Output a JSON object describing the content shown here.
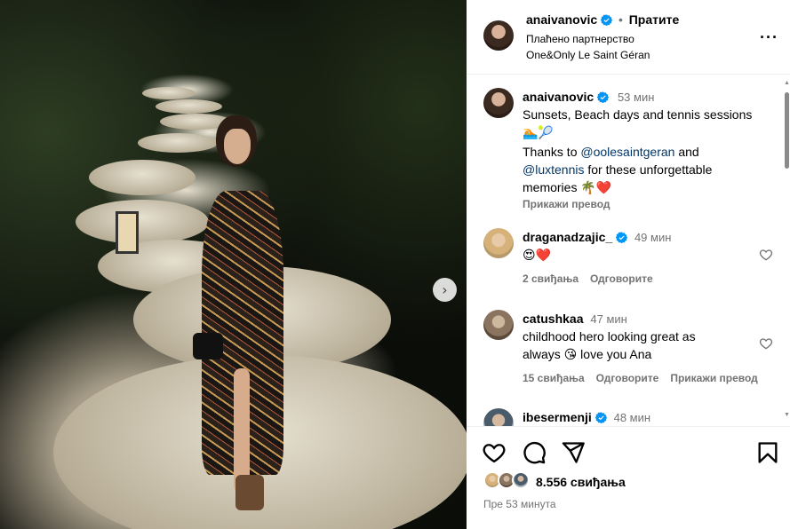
{
  "post": {
    "author": "anaivanovic",
    "follow_label": "Пратите",
    "separator": "•",
    "partnership": "Плаћено партнерство",
    "location": "One&Only Le Saint Géran"
  },
  "caption": {
    "author": "anaivanovic",
    "time": "53 мин",
    "line1": "Sunsets, Beach days and tennis sessions",
    "line1_emoji": "🏊🎾",
    "thanks_prefix": "Thanks to ",
    "mention1": "@oolesaintgeran",
    "thanks_and": " and",
    "mention2": "@luxtennis",
    "thanks_suffix": " for these unforgettable",
    "memories": "memories 🌴❤️",
    "translate": "Прикажи превод"
  },
  "comments": [
    {
      "user": "draganadzajic_",
      "verified": true,
      "time": "49 мин",
      "text": "😍❤️",
      "likes": "2 свиђања",
      "reply": "Одговорите"
    },
    {
      "user": "catushkaa",
      "verified": false,
      "time": "47 мин",
      "text_line1": "childhood hero looking great as",
      "text_line2": "always 😘 love you Ana",
      "likes": "15 свиђања",
      "reply": "Одговорите",
      "translate": "Прикажи превод"
    },
    {
      "user": "ibesermenji",
      "verified": true,
      "time": "48 мин"
    }
  ],
  "footer": {
    "likes": "8.556 свиђања",
    "time": "Пре 53 минута"
  },
  "icons": {
    "like": "heart-icon",
    "comment": "comment-icon",
    "share": "share-icon",
    "save": "bookmark-icon",
    "more": "more-options-icon",
    "next": "chevron-right-icon",
    "verified": "verified-badge-icon"
  },
  "colors": {
    "verified": "#0095f6",
    "link": "#00376b",
    "muted": "#737373"
  }
}
